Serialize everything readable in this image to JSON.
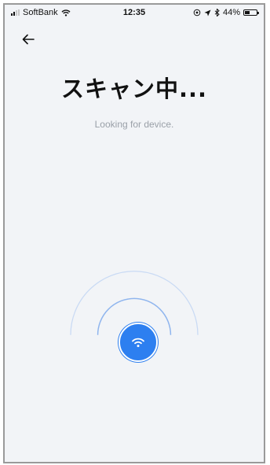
{
  "status_bar": {
    "carrier": "SoftBank",
    "time": "12:35",
    "battery_text": "44%",
    "battery_level": 0.44
  },
  "page": {
    "title": "スキャン中...",
    "subtitle": "Looking for device."
  },
  "icons": {
    "back": "arrow-left-icon",
    "wifi": "wifi-icon",
    "scan_button": "wifi-icon"
  },
  "colors": {
    "accent": "#2d7ff0",
    "background": "#f2f4f7",
    "subtitle": "#9aa0a8",
    "arc": "#b9d0f2"
  }
}
